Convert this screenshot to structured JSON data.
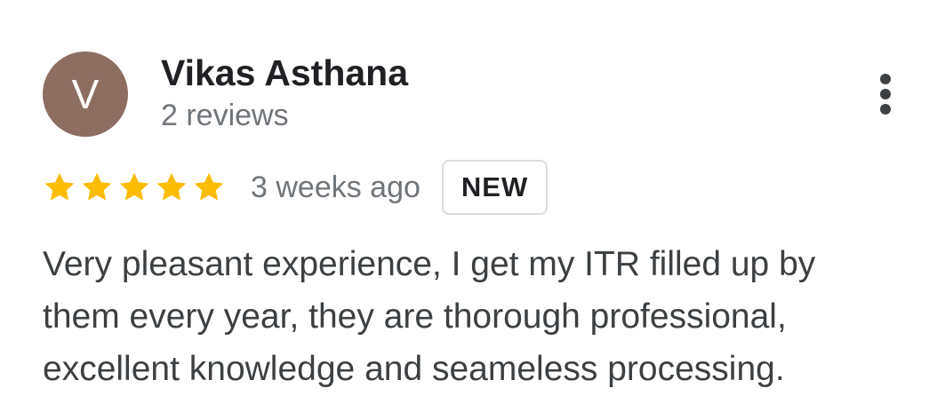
{
  "review": {
    "avatar": {
      "letter": "V",
      "color": "#8d6e63"
    },
    "reviewer_name": "Vikas Asthana",
    "review_count": "2 reviews",
    "menu_icon": "more-vertical-icon",
    "rating": {
      "stars": 5,
      "max_stars": 5,
      "star_color": "#fbbc04",
      "icon": "star-icon"
    },
    "date": "3 weeks ago",
    "badge": "NEW",
    "text": "Very pleasant experience, I get my ITR filled up by\nthem every year, they are thorough professional,\nexcellent knowledge and seameless processing."
  }
}
